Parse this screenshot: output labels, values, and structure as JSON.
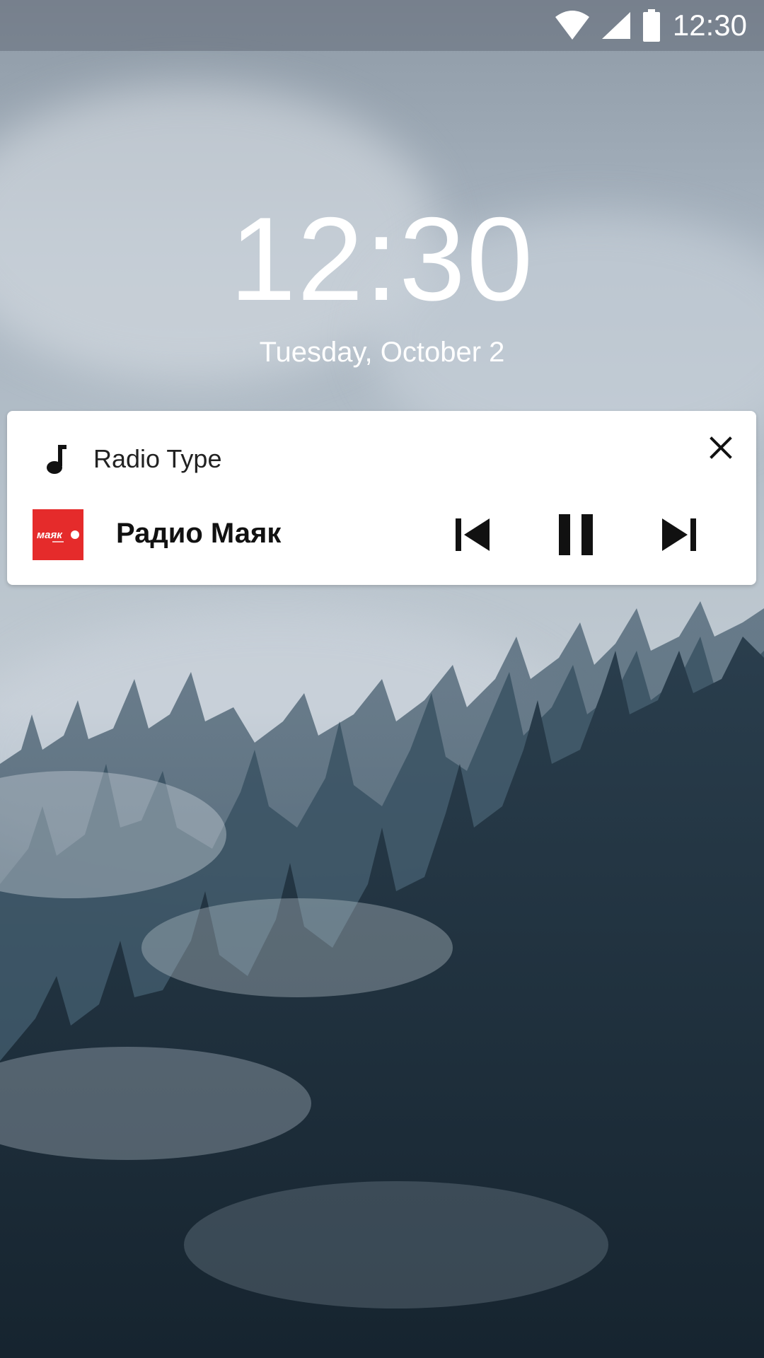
{
  "status_bar": {
    "time": "12:30",
    "icons": [
      "wifi-icon",
      "cellular-signal-icon",
      "battery-icon"
    ]
  },
  "lock_screen": {
    "time": "12:30",
    "date": "Tuesday, October 2"
  },
  "notification": {
    "app_icon": "music-note-icon",
    "app_name": "Radio Type",
    "station": {
      "name": "Радио Маяк",
      "logo_text": "маяк",
      "logo_color": "#e52b2b"
    },
    "controls": [
      "previous-icon",
      "pause-icon",
      "next-icon"
    ],
    "dismiss_icon": "close-icon"
  }
}
